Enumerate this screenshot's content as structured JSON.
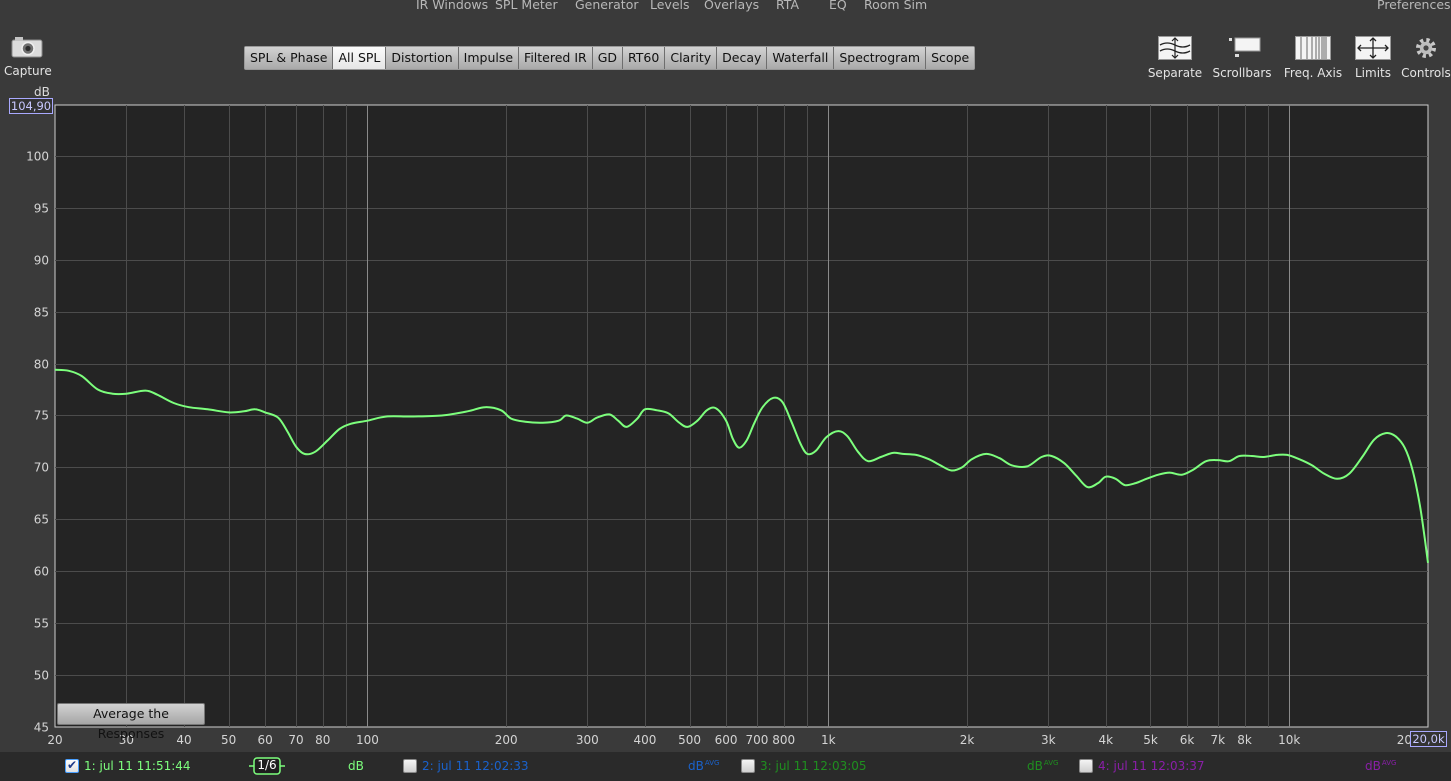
{
  "top_menu": [
    "IR Windows",
    "SPL Meter",
    "Generator",
    "Levels",
    "Overlays",
    "RTA",
    "EQ",
    "Room Sim",
    "Preferences"
  ],
  "capture": {
    "label": "Capture",
    "icon": "camera-icon"
  },
  "tabs": [
    {
      "label": "SPL & Phase",
      "active": false
    },
    {
      "label": "All SPL",
      "active": true
    },
    {
      "label": "Distortion",
      "active": false
    },
    {
      "label": "Impulse",
      "active": false
    },
    {
      "label": "Filtered IR",
      "active": false
    },
    {
      "label": "GD",
      "active": false
    },
    {
      "label": "RT60",
      "active": false
    },
    {
      "label": "Clarity",
      "active": false
    },
    {
      "label": "Decay",
      "active": false
    },
    {
      "label": "Waterfall",
      "active": false
    },
    {
      "label": "Spectrogram",
      "active": false
    },
    {
      "label": "Scope",
      "active": false
    }
  ],
  "toolbar": [
    {
      "label": "Separate",
      "icon": "separate-traces-icon"
    },
    {
      "label": "Scrollbars",
      "icon": "scrollbars-icon"
    },
    {
      "label": "Freq. Axis",
      "icon": "freq-axis-icon"
    },
    {
      "label": "Limits",
      "icon": "limits-icon"
    },
    {
      "label": "Controls",
      "icon": "gear-icon"
    }
  ],
  "y_axis_unit": "dB",
  "y_max_value": "104,90",
  "x_max_value": "20,0k",
  "average_button": "Average the Responses",
  "legend": [
    {
      "label": "1: jul 11 11:51:44",
      "checked": true,
      "color": "#7dff7d",
      "smoothing": "1/6",
      "unit": "dB",
      "unit_sup": ""
    },
    {
      "label": "2: jul 11 12:02:33",
      "checked": false,
      "color": "#1a62cc",
      "unit": "dB",
      "unit_sup": "AVG"
    },
    {
      "label": "3: jul 11 12:03:05",
      "checked": false,
      "color": "#1f8f1f",
      "unit": "dB",
      "unit_sup": "AVG"
    },
    {
      "label": "4: jul 11 12:03:37",
      "checked": false,
      "color": "#8a1fa8",
      "unit": "dB",
      "unit_sup": "AVG"
    }
  ],
  "chart_data": {
    "type": "line",
    "x_scale": "log",
    "xlim": [
      21,
      20000
    ],
    "ylim": [
      45,
      104.9
    ],
    "ylabel": "dB",
    "grid": true,
    "y_ticks": [
      45,
      50,
      55,
      60,
      65,
      70,
      75,
      80,
      85,
      90,
      95,
      100
    ],
    "x_ticks": [
      {
        "value": 20,
        "label": "20"
      },
      {
        "value": 30,
        "label": "30"
      },
      {
        "value": 40,
        "label": "40"
      },
      {
        "value": 50,
        "label": "50"
      },
      {
        "value": 60,
        "label": "60"
      },
      {
        "value": 70,
        "label": "70"
      },
      {
        "value": 80,
        "label": "80"
      },
      {
        "value": 100,
        "label": "100"
      },
      {
        "value": 200,
        "label": "200"
      },
      {
        "value": 300,
        "label": "300"
      },
      {
        "value": 400,
        "label": "400"
      },
      {
        "value": 500,
        "label": "500"
      },
      {
        "value": 600,
        "label": "600"
      },
      {
        "value": 700,
        "label": "700"
      },
      {
        "value": 800,
        "label": "800"
      },
      {
        "value": 1000,
        "label": "1k"
      },
      {
        "value": 2000,
        "label": "2k"
      },
      {
        "value": 3000,
        "label": "3k"
      },
      {
        "value": 4000,
        "label": "4k"
      },
      {
        "value": 5000,
        "label": "5k"
      },
      {
        "value": 6000,
        "label": "6k"
      },
      {
        "value": 7000,
        "label": "7k"
      },
      {
        "value": 8000,
        "label": "8k"
      },
      {
        "value": 10000,
        "label": "10k"
      },
      {
        "value": 20000,
        "label": "20"
      }
    ],
    "series": [
      {
        "name": "1: jul 11 11:51:44",
        "color": "#7dff7d",
        "points": [
          [
            21,
            79.4
          ],
          [
            22.5,
            79.3
          ],
          [
            24,
            78.8
          ],
          [
            26,
            77.5
          ],
          [
            28,
            77.1
          ],
          [
            30,
            77.1
          ],
          [
            33,
            77.4
          ],
          [
            35,
            77.0
          ],
          [
            38,
            76.2
          ],
          [
            41,
            75.8
          ],
          [
            45,
            75.6
          ],
          [
            50,
            75.3
          ],
          [
            54,
            75.4
          ],
          [
            57,
            75.6
          ],
          [
            60,
            75.3
          ],
          [
            64,
            74.8
          ],
          [
            67,
            73.5
          ],
          [
            70,
            72.0
          ],
          [
            73,
            71.3
          ],
          [
            77,
            71.5
          ],
          [
            82,
            72.6
          ],
          [
            87,
            73.7
          ],
          [
            92,
            74.2
          ],
          [
            100,
            74.5
          ],
          [
            110,
            74.9
          ],
          [
            125,
            74.9
          ],
          [
            145,
            75.0
          ],
          [
            165,
            75.4
          ],
          [
            180,
            75.8
          ],
          [
            195,
            75.5
          ],
          [
            205,
            74.7
          ],
          [
            220,
            74.4
          ],
          [
            240,
            74.3
          ],
          [
            260,
            74.5
          ],
          [
            270,
            75.0
          ],
          [
            285,
            74.7
          ],
          [
            300,
            74.3
          ],
          [
            315,
            74.8
          ],
          [
            335,
            75.1
          ],
          [
            350,
            74.5
          ],
          [
            365,
            73.9
          ],
          [
            385,
            74.7
          ],
          [
            400,
            75.6
          ],
          [
            425,
            75.5
          ],
          [
            450,
            75.2
          ],
          [
            475,
            74.3
          ],
          [
            495,
            73.9
          ],
          [
            520,
            74.5
          ],
          [
            545,
            75.5
          ],
          [
            570,
            75.7
          ],
          [
            600,
            74.5
          ],
          [
            620,
            72.8
          ],
          [
            640,
            71.9
          ],
          [
            665,
            72.6
          ],
          [
            690,
            74.2
          ],
          [
            720,
            75.8
          ],
          [
            760,
            76.7
          ],
          [
            795,
            76.3
          ],
          [
            830,
            74.5
          ],
          [
            870,
            72.3
          ],
          [
            900,
            71.3
          ],
          [
            940,
            71.6
          ],
          [
            990,
            72.9
          ],
          [
            1050,
            73.5
          ],
          [
            1100,
            73.0
          ],
          [
            1160,
            71.5
          ],
          [
            1220,
            70.6
          ],
          [
            1300,
            71.0
          ],
          [
            1380,
            71.4
          ],
          [
            1450,
            71.3
          ],
          [
            1550,
            71.2
          ],
          [
            1650,
            70.8
          ],
          [
            1750,
            70.2
          ],
          [
            1850,
            69.7
          ],
          [
            1950,
            70.0
          ],
          [
            2050,
            70.8
          ],
          [
            2200,
            71.3
          ],
          [
            2350,
            70.9
          ],
          [
            2500,
            70.2
          ],
          [
            2700,
            70.1
          ],
          [
            2900,
            71.0
          ],
          [
            3050,
            71.1
          ],
          [
            3250,
            70.4
          ],
          [
            3450,
            69.2
          ],
          [
            3650,
            68.1
          ],
          [
            3850,
            68.5
          ],
          [
            4000,
            69.1
          ],
          [
            4200,
            68.9
          ],
          [
            4400,
            68.3
          ],
          [
            4650,
            68.5
          ],
          [
            4900,
            68.9
          ],
          [
            5200,
            69.3
          ],
          [
            5500,
            69.5
          ],
          [
            5850,
            69.3
          ],
          [
            6200,
            69.8
          ],
          [
            6600,
            70.6
          ],
          [
            7000,
            70.7
          ],
          [
            7400,
            70.6
          ],
          [
            7800,
            71.1
          ],
          [
            8300,
            71.1
          ],
          [
            8800,
            71.0
          ],
          [
            9400,
            71.2
          ],
          [
            9900,
            71.2
          ],
          [
            10500,
            70.8
          ],
          [
            11200,
            70.2
          ],
          [
            11900,
            69.4
          ],
          [
            12700,
            68.9
          ],
          [
            13500,
            69.4
          ],
          [
            14400,
            71.0
          ],
          [
            15300,
            72.7
          ],
          [
            16200,
            73.3
          ],
          [
            17000,
            73.0
          ],
          [
            17800,
            71.9
          ],
          [
            18500,
            69.8
          ],
          [
            19200,
            66.4
          ],
          [
            19700,
            63.0
          ],
          [
            20000,
            60.8
          ]
        ]
      }
    ]
  }
}
